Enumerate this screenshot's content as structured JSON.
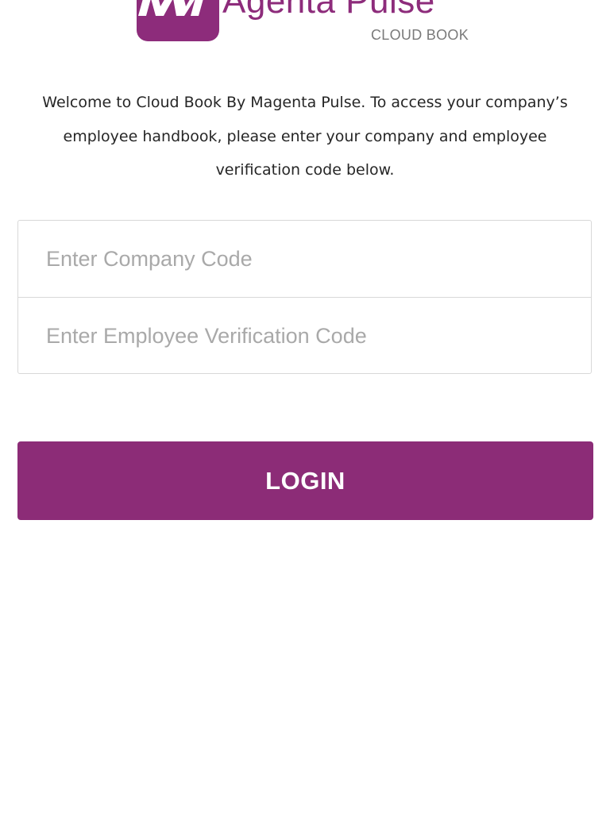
{
  "brand": {
    "name": "Agenta Pulse",
    "subtitle": "CLOUD BOOK",
    "logo_mark_icon": "m-logo-icon",
    "color": "#8d2c7b"
  },
  "intro": {
    "text": "Welcome to Cloud Book By Magenta Pulse. To access your company’s employee handbook, please enter your company and employee verification code below."
  },
  "form": {
    "company_code": {
      "placeholder": "Enter Company Code",
      "value": ""
    },
    "employee_code": {
      "placeholder": "Enter Employee Verification Code",
      "value": ""
    },
    "login_label": "LOGIN",
    "button_color": "#8c2c77"
  }
}
